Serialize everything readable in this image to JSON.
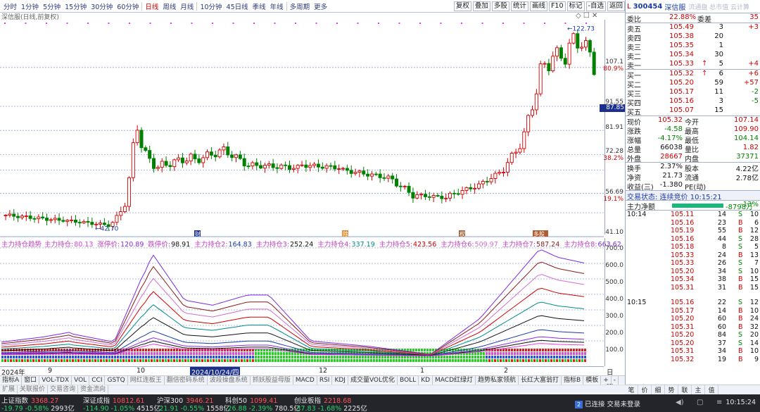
{
  "toolbar": {
    "periods": [
      "分时",
      "1分钟",
      "5分钟",
      "15分钟",
      "30分钟",
      "60分钟",
      "日线",
      "周线",
      "月线",
      "10分钟",
      "45日线",
      "季线",
      "年线",
      "多周期",
      "更多"
    ],
    "active_period": "日线",
    "right_buttons": [
      "复权",
      "叠加",
      "多股",
      "统计",
      "画线",
      "F10",
      "标记",
      "-自选",
      "返回"
    ]
  },
  "chart": {
    "title": "深信服(日线,前复权)",
    "window_icons": "◇ ☐ ✕",
    "price_axis": {
      "labels": [
        "107.1",
        "80.9%",
        "91.55",
        "81.91",
        "72.28",
        "38.2%",
        "56.69",
        "19.1%",
        "41.10"
      ],
      "current_price": "87.85",
      "high_label": "122.73",
      "low_label": "42.70"
    },
    "indicator_axis": [
      "700.0",
      "600.0",
      "500.0",
      "400.0",
      "300.0",
      "200.0",
      "100.0"
    ],
    "event_markers": [
      "财",
      "除",
      "权",
      "多股"
    ],
    "date_axis": {
      "items": [
        "2024年",
        "9",
        "10",
        "2024/10/24/四",
        "12",
        "1",
        "2"
      ]
    }
  },
  "indicator": {
    "name": "主力持仓趋势",
    "items": [
      {
        "label": "主力持仓:",
        "value": "80.13",
        "color": "#e040e0"
      },
      {
        "label": "涨停价:",
        "value": "120.89",
        "color": "#8a2be2"
      },
      {
        "label": "跌停价:",
        "value": "98.91",
        "color": "#111111"
      },
      {
        "label": "主力持仓2:",
        "value": "164.83",
        "color": "#1a3ba8"
      },
      {
        "label": "主力持仓3:",
        "value": "252.24",
        "color": "#111111"
      },
      {
        "label": "主力持仓4:",
        "value": "337.19",
        "color": "#008b8b"
      },
      {
        "label": "主力持仓5:",
        "value": "423.56",
        "color": "#d00000"
      },
      {
        "label": "主力持仓6:",
        "value": "509.97",
        "color": "#d070d0"
      },
      {
        "label": "主力持仓7:",
        "value": "587.24",
        "color": "#8b1a1a"
      },
      {
        "label": "主力持仓8:",
        "value": "663.62",
        "color": "#7b2be2"
      }
    ]
  },
  "tabs_row1": [
    "指标A",
    "窗口",
    "VOL-TDX",
    "VOL",
    "CCI",
    "GSTQ",
    "网红连板王",
    "翻倍密码系统",
    "波段操盘系统",
    "抓妖股益母版",
    "MACD",
    "RSI",
    "KDJ",
    "成交量VOL优化",
    "BOLL",
    "KD",
    "MACD红绿灯",
    "趋势私家领航",
    "长红大富翁打",
    "指标B",
    "模板",
    "+",
    "-"
  ],
  "tabs_row2": [
    "扩展",
    "关联报价",
    "交易咨询",
    "资金流向"
  ],
  "axis_period": "日线",
  "quote": {
    "market": "L",
    "code": "300454",
    "name": "深信服",
    "ghost_text": "流通盘 总市值 云计算",
    "wei_bi": {
      "label": "委比",
      "value": "22.88%",
      "label2": "委差",
      "value2": "35"
    },
    "sells": [
      {
        "label": "卖五",
        "price": "105.49",
        "vol": "3",
        "chg": "+3"
      },
      {
        "label": "卖四",
        "price": "105.38",
        "vol": "20",
        "chg": ""
      },
      {
        "label": "卖三",
        "price": "105.35",
        "vol": "1",
        "chg": ""
      },
      {
        "label": "卖二",
        "price": "105.34",
        "vol": "30",
        "chg": ""
      },
      {
        "label": "卖一",
        "price": "105.33",
        "vol": "5",
        "chg": "+4"
      }
    ],
    "buys": [
      {
        "label": "买一",
        "price": "105.32",
        "vol": "6",
        "chg": "+6"
      },
      {
        "label": "买二",
        "price": "105.20",
        "vol": "59",
        "chg": "+57"
      },
      {
        "label": "买三",
        "price": "105.17",
        "vol": "11",
        "chg": "-2"
      },
      {
        "label": "买四",
        "price": "105.16",
        "vol": "3",
        "chg": "-5"
      },
      {
        "label": "买五",
        "price": "105.07",
        "vol": "15",
        "chg": ""
      }
    ],
    "stats": [
      {
        "l1": "现价",
        "v1": "105.32",
        "c1": "red",
        "l2": "今开",
        "v2": "107.14",
        "c2": "red"
      },
      {
        "l1": "涨跌",
        "v1": "-4.58",
        "c1": "grn",
        "l2": "最高",
        "v2": "109.90",
        "c2": "red"
      },
      {
        "l1": "涨幅",
        "v1": "-4.17%",
        "c1": "grn",
        "l2": "最低",
        "v2": "104.14",
        "c2": "grn"
      },
      {
        "l1": "总量",
        "v1": "66038",
        "c1": "blk",
        "l2": "量比",
        "v2": "1.82",
        "c2": "red"
      },
      {
        "l1": "外盘",
        "v1": "28667",
        "c1": "red",
        "l2": "内盘",
        "v2": "37371",
        "c2": "grn"
      }
    ],
    "stats2": [
      {
        "l1": "换手",
        "v1": "2.37%",
        "c1": "blk",
        "l2": "股本",
        "v2": "4.22亿",
        "c2": "blk"
      },
      {
        "l1": "净资",
        "v1": "21.73",
        "c1": "blk",
        "l2": "流通",
        "v2": "2.78亿",
        "c2": "blk"
      },
      {
        "l1": "收益(三)",
        "v1": "-1.380",
        "c1": "blk",
        "l2": "PE(动)",
        "v2": "",
        "c2": "blk"
      }
    ],
    "status": "交易状态: 连续竞价 10:15:21",
    "flow": {
      "label": "主力净额",
      "value": "-8798万",
      "pct": "-13%"
    }
  },
  "ticks": {
    "group1": {
      "time": "10:14",
      "rows": [
        {
          "p": "105.11",
          "v": "14",
          "d": "S",
          "c": "10"
        },
        {
          "p": "105.16",
          "v": "23",
          "d": "B",
          "c": "6"
        },
        {
          "p": "105.19",
          "v": "55",
          "d": "B",
          "c": "12"
        },
        {
          "p": "105.16",
          "v": "44",
          "d": "S",
          "c": "28"
        },
        {
          "p": "105.18",
          "v": "8",
          "d": "S",
          "c": "5"
        },
        {
          "p": "105.33",
          "v": "24",
          "d": "B",
          "c": "13"
        },
        {
          "p": "105.33",
          "v": "26",
          "d": "S",
          "c": "7"
        },
        {
          "p": "105.20",
          "v": "34",
          "d": "S",
          "c": "10"
        },
        {
          "p": "105.34",
          "v": "38",
          "d": "B",
          "c": "15"
        },
        {
          "p": "105.31",
          "v": "31",
          "d": "B",
          "c": "15"
        }
      ]
    },
    "group2": {
      "time": "10:15",
      "rows": [
        {
          "p": "105.16",
          "v": "22",
          "d": "S",
          "c": "12"
        },
        {
          "p": "105.17",
          "v": "14",
          "d": "B",
          "c": "10"
        },
        {
          "p": "105.20",
          "v": "60",
          "d": "B",
          "c": "24"
        },
        {
          "p": "105.31",
          "v": "60",
          "d": "B",
          "c": "32"
        },
        {
          "p": "105.20",
          "v": "84",
          "d": "S",
          "c": "20"
        },
        {
          "p": "105.20",
          "v": "37",
          "d": "S",
          "c": "14"
        },
        {
          "p": "105.31",
          "v": "34",
          "d": "B",
          "c": "10"
        },
        {
          "p": "105.32",
          "v": "19",
          "d": "B",
          "c": "9"
        }
      ]
    }
  },
  "right_bottom_tabs": [
    "笔",
    "价",
    "细",
    "势",
    "联",
    "主",
    "值"
  ],
  "indices": [
    {
      "name": "上证指数",
      "value": "3368.27",
      "chg": "-19.79",
      "pct": "-0.58%",
      "amt": "2993亿",
      "dir": "dn"
    },
    {
      "name": "深证成指",
      "value": "10812.61",
      "chg": "-114.90",
      "pct": "-1.05%",
      "amt": "4515亿",
      "dir": "dn"
    },
    {
      "name": "沪深300",
      "value": "3946.21",
      "chg": "-21.91",
      "pct": "-0.55%",
      "amt": "1558亿",
      "dir": "dn"
    },
    {
      "name": "科创50",
      "value": "1099.41",
      "chg": "-26.88",
      "pct": "-2.39%",
      "amt": "780.5亿",
      "dir": "dn"
    },
    {
      "name": "创业板指",
      "value": "2218.68",
      "chg": "-37.83",
      "pct": "-1.68%",
      "amt": "2225亿",
      "dir": "dn"
    }
  ],
  "connection": {
    "badge": "2",
    "text": "已连接 交易未登录"
  },
  "clock": "10:15:24",
  "colors": {
    "up": "#d00000",
    "down": "#008000",
    "navy": "#1c2f8c",
    "magenta": "#e040e0"
  }
}
